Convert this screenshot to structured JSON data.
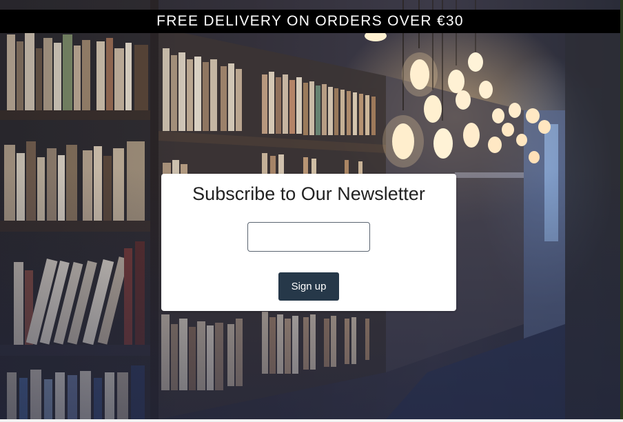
{
  "promo": {
    "text": "FREE DELIVERY ON ORDERS OVER €30"
  },
  "newsletter": {
    "title": "Subscribe to Our Newsletter",
    "email_value": "",
    "email_placeholder": "",
    "signup_label": "Sign up"
  },
  "colors": {
    "promo_bar_bg": "#000000",
    "button_bg": "#263849",
    "card_bg": "#ffffff"
  },
  "background": {
    "subject": "library-bookshelves-photo"
  }
}
